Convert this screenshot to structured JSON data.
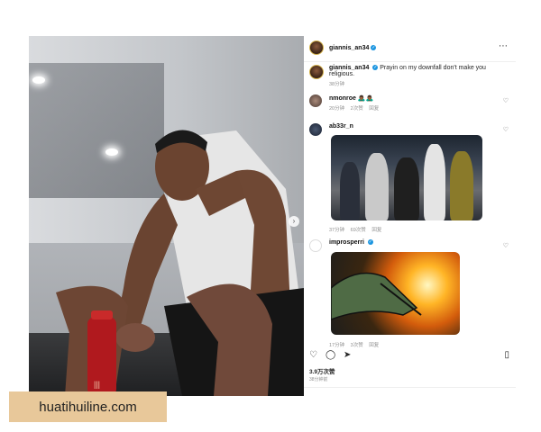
{
  "post": {
    "author": "giannis_an34",
    "caption": "Prayin on my downfall don't make you religious.",
    "caption_time": "38分钟",
    "more_icon": "⋯",
    "likes": "3.9万次赞",
    "posted_time": "38分钟前"
  },
  "comments": [
    {
      "user": "nmonroe",
      "text": "🙇🏾‍♂️🙇🏾‍♂️",
      "time": "20分钟",
      "likes": "2次赞",
      "reply": "回复"
    },
    {
      "user": "ab33r_n",
      "text": "",
      "time": "37分钟",
      "likes": "69次赞",
      "reply": "回复"
    },
    {
      "user": "improsperri",
      "text": "",
      "time": "17分钟",
      "likes": "3次赞",
      "reply": "回复"
    }
  ],
  "watermark": "huatihuiline.com",
  "colors": {
    "verified": "#1b95e0",
    "watermark_bg": "#e8c89a"
  }
}
